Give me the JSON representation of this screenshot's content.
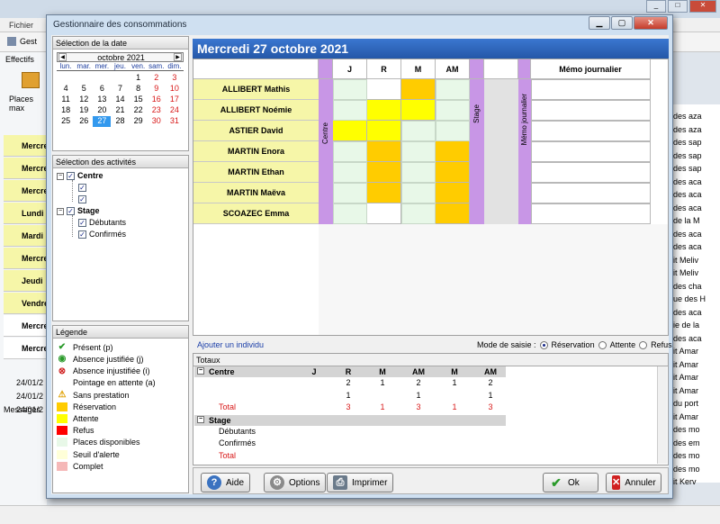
{
  "background": {
    "menu": [
      "Fichier"
    ],
    "toolbar_item": "Gest",
    "left_tab": "Effectifs",
    "places_label": "Places max",
    "rows": [
      {
        "label": "Mercred",
        "yellow": true
      },
      {
        "label": "Mercred",
        "yellow": true
      },
      {
        "label": "Mercred",
        "yellow": true
      },
      {
        "label": "Lundi",
        "yellow": true
      },
      {
        "label": "Mardi",
        "yellow": true
      },
      {
        "label": "Mercred",
        "yellow": true
      },
      {
        "label": "Jeudi",
        "yellow": true
      },
      {
        "label": "Vendre",
        "yellow": true
      },
      {
        "label": "Mercred",
        "yellow": false
      },
      {
        "label": "Mercred",
        "yellow": false
      }
    ],
    "messages_label": "Messages",
    "messages": [
      "24/01/2",
      "24/01/2",
      "24/01/2"
    ],
    "right_list": [
      "des aza",
      "des aza",
      "des sap",
      "des sap",
      "des sap",
      "des aca",
      "des aca",
      "des aca",
      "de la M",
      "des aca",
      "des aca",
      "it Meliv",
      "it Meliv",
      "des cha",
      "ue des H",
      "des aca",
      "ie de la",
      "des aca",
      "it Amar",
      "it Amar",
      "it Amar",
      "it Amar",
      "du port",
      "it Amar",
      "des mo",
      "des em",
      "des mo",
      "des mo",
      "it Kerv"
    ]
  },
  "dialog": {
    "title": "Gestionnaire des consommations",
    "date_panel": {
      "title": "Sélection de la date",
      "month": "octobre 2021",
      "weekdays": [
        "lun.",
        "mar.",
        "mer.",
        "jeu.",
        "ven.",
        "sam.",
        "dim."
      ],
      "weeks": [
        [
          "",
          "",
          "",
          "",
          "1",
          "2",
          "3"
        ],
        [
          "4",
          "5",
          "6",
          "7",
          "8",
          "9",
          "10"
        ],
        [
          "11",
          "12",
          "13",
          "14",
          "15",
          "16",
          "17"
        ],
        [
          "18",
          "19",
          "20",
          "21",
          "22",
          "23",
          "24"
        ],
        [
          "25",
          "26",
          "27",
          "28",
          "29",
          "30",
          "31"
        ]
      ],
      "selected_day": "27"
    },
    "activities_panel": {
      "title": "Sélection des activités",
      "groups": [
        {
          "label": "Centre",
          "children": [
            "",
            ""
          ]
        },
        {
          "label": "Stage",
          "children": [
            "Débutants",
            "Confirmés"
          ]
        }
      ],
      "check_glyph": "✓",
      "collapse_glyph": "−"
    },
    "legend_panel": {
      "title": "Légende",
      "items": [
        {
          "label": "Présent (p)",
          "icon": "check-icon",
          "glyph": "✔",
          "color": "#2a9a2a"
        },
        {
          "label": "Absence justifiée (j)",
          "icon": "circle-ok-icon",
          "glyph": "◉",
          "color": "#2a9a2a"
        },
        {
          "label": "Absence injustifiée (i)",
          "icon": "circle-x-icon",
          "glyph": "⊗",
          "color": "#d02020"
        },
        {
          "label": "Pointage en attente (a)",
          "icon": "",
          "glyph": "",
          "color": ""
        },
        {
          "label": "Sans prestation",
          "icon": "warning-icon",
          "glyph": "⚠",
          "color": "#e0a000"
        },
        {
          "label": "Réservation",
          "swatch": "#ffcc00"
        },
        {
          "label": "Attente",
          "swatch": "#ffff00"
        },
        {
          "label": "Refus",
          "swatch": "#ff0000"
        },
        {
          "label": "Places disponibles",
          "swatch": "#e8f8e8"
        },
        {
          "label": "Seuil d'alerte",
          "swatch": "#ffffd8"
        },
        {
          "label": "Complet",
          "swatch": "#f5b8b8"
        }
      ]
    },
    "planning": {
      "date_title": "Mercredi 27 octobre 2021",
      "columns": [
        "J",
        "R",
        "M",
        "AM"
      ],
      "group_label_centre": "Centre",
      "group_label_stage": "Stage",
      "memo_label": "Mémo journalier",
      "memo_header": "Mémo journalier",
      "colors": {
        "reservation": "#ffcc00",
        "attente": "#ffff00",
        "dispo": "#e8f8e8",
        "empty": "#ffffff"
      },
      "rows": [
        {
          "name": "ALLIBERT Mathis",
          "cells": [
            "dispo",
            "empty",
            "reservation",
            "dispo"
          ]
        },
        {
          "name": "ALLIBERT Noémie",
          "cells": [
            "dispo",
            "attente",
            "attente",
            "dispo"
          ]
        },
        {
          "name": "ASTIER David",
          "cells": [
            "attente",
            "attente",
            "dispo",
            "dispo"
          ]
        },
        {
          "name": "MARTIN Enora",
          "cells": [
            "dispo",
            "reservation",
            "dispo",
            "reservation"
          ]
        },
        {
          "name": "MARTIN Ethan",
          "cells": [
            "dispo",
            "reservation",
            "dispo",
            "reservation"
          ]
        },
        {
          "name": "MARTIN Maëva",
          "cells": [
            "dispo",
            "reservation",
            "dispo",
            "reservation"
          ]
        },
        {
          "name": "SCOAZEC Emma",
          "cells": [
            "dispo",
            "empty",
            "dispo",
            "reservation"
          ]
        }
      ],
      "add_link": "Ajouter un individu",
      "mode_label": "Mode de saisie :",
      "modes": [
        {
          "label": "Réservation",
          "selected": true
        },
        {
          "label": "Attente",
          "selected": false
        },
        {
          "label": "Refus",
          "selected": false
        }
      ]
    },
    "totals": {
      "title": "Totaux",
      "columns": [
        "J",
        "R",
        "M",
        "AM",
        "M",
        "AM"
      ],
      "groups": [
        {
          "label": "Centre",
          "rows": [
            {
              "label": "",
              "values": [
                "",
                "2",
                "1",
                "2",
                "1",
                "2"
              ],
              "total": false
            },
            {
              "label": "",
              "values": [
                "",
                "1",
                "",
                "1",
                "",
                "1"
              ],
              "total": false
            },
            {
              "label": "Total",
              "values": [
                "",
                "3",
                "1",
                "3",
                "1",
                "3"
              ],
              "total": true
            }
          ]
        },
        {
          "label": "Stage",
          "rows": [
            {
              "label": "Débutants",
              "values": [],
              "total": false
            },
            {
              "label": "Confirmés",
              "values": [],
              "total": false
            },
            {
              "label": "Total",
              "values": [],
              "total": true
            }
          ]
        }
      ]
    },
    "buttons": {
      "help": "Aide",
      "options": "Options",
      "print": "Imprimer",
      "ok": "Ok",
      "cancel": "Annuler"
    }
  }
}
